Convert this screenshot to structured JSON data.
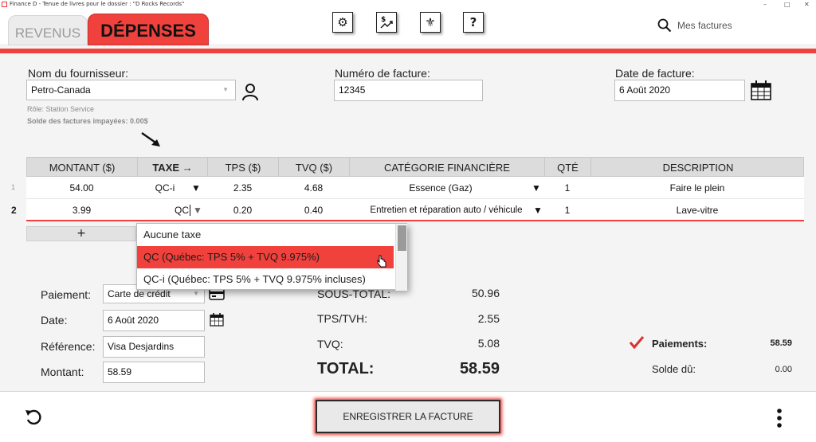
{
  "window": {
    "title": "Finance D - Tenue de livres pour le dossier : \"D Rocks Records\"",
    "controls": [
      "–",
      "□",
      "✕"
    ]
  },
  "tabs": {
    "revenus": "REVENUS",
    "depenses": "DÉPENSES"
  },
  "toolbar": {
    "gear": "⚙",
    "dollar": "$",
    "fleur": "⚜",
    "help": "?"
  },
  "search": {
    "placeholder": "Mes factures"
  },
  "supplier": {
    "label": "Nom du fournisseur:",
    "value": "Petro-Canada",
    "role": "Rôle: Station Service",
    "unpaid": "Solde des factures impayées: 0.00$"
  },
  "invoice_number": {
    "label": "Numéro de facture:",
    "value": "12345"
  },
  "invoice_date": {
    "label": "Date de facture:",
    "value": "6 Août 2020"
  },
  "table": {
    "headers": [
      "MONTANT ($)",
      "TAXE →",
      "TPS ($)",
      "TVQ ($)",
      "CATÉGORIE FINANCIÈRE",
      "QTÉ",
      "DESCRIPTION"
    ],
    "rows": [
      {
        "num": "1",
        "montant": "54.00",
        "taxe": "QC-i",
        "tps": "2.35",
        "tvq": "4.68",
        "categorie": "Essence (Gaz)",
        "qte": "1",
        "description": "Faire le plein"
      },
      {
        "num": "2",
        "montant": "3.99",
        "taxe": "QC",
        "tps": "0.20",
        "tvq": "0.40",
        "categorie": "Entretien et réparation auto / véhicule",
        "qte": "1",
        "description": "Lave-vitre"
      }
    ],
    "add_label": "+"
  },
  "tax_dropdown": {
    "options": [
      "Aucune taxe",
      "QC (Québec: TPS 5% + TVQ 9.975%)",
      "QC-i (Québec: TPS 5% + TVQ 9.975% incluses)"
    ],
    "highlighted": 1
  },
  "payment": {
    "method_label": "Paiement:",
    "method_value": "Carte de crédit",
    "date_label": "Date:",
    "date_value": "6 Août 2020",
    "reference_label": "Référence:",
    "reference_value": "Visa Desjardins",
    "amount_label": "Montant:",
    "amount_value": "58.59"
  },
  "totals": {
    "subtotal_label": "SOUS-TOTAL:",
    "subtotal_value": "50.96",
    "tps_label": "TPS/TVH:",
    "tps_value": "2.55",
    "tvq_label": "TVQ:",
    "tvq_value": "5.08",
    "total_label": "TOTAL:",
    "total_value": "58.59"
  },
  "summary": {
    "payments_label": "Paiements:",
    "payments_value": "58.59",
    "balance_label": "Solde dû:",
    "balance_value": "0.00"
  },
  "footer": {
    "save_label": "ENREGISTRER LA FACTURE"
  },
  "colors": {
    "accent": "#f0413c",
    "header_bg": "#ffffff",
    "body_bg": "#f4f4f4",
    "check": "#d9332f"
  }
}
